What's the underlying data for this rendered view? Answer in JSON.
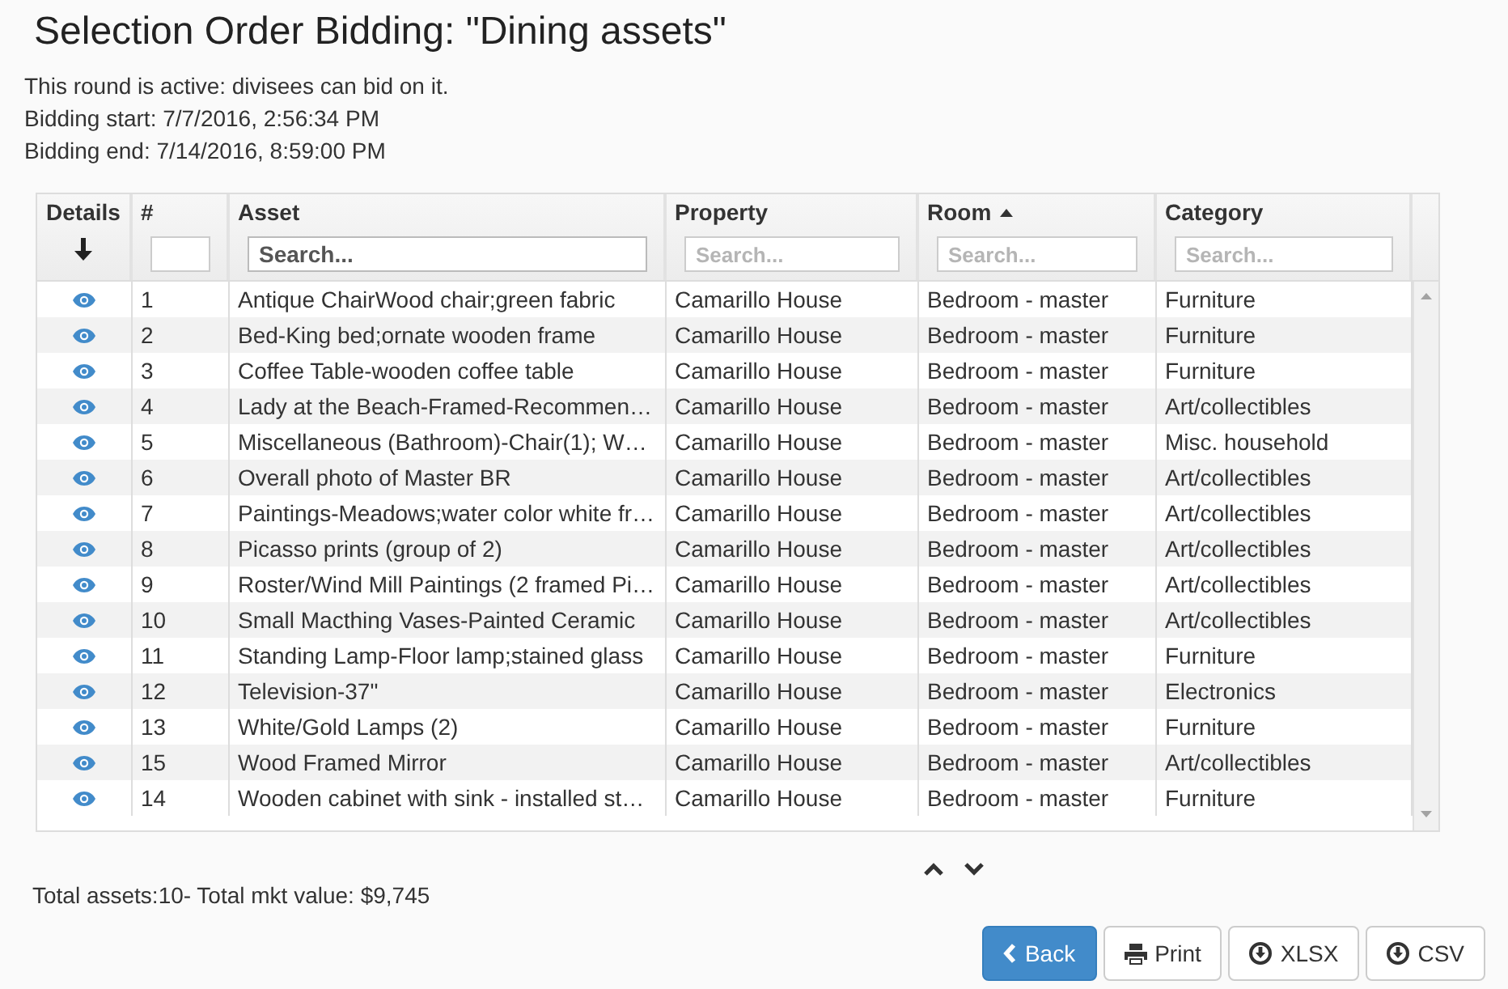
{
  "page": {
    "title": "Selection Order Bidding: \"Dining assets\"",
    "info_lines": [
      "This round is active: divisees can bid on it.",
      "Bidding start: 7/7/2016, 2:56:34 PM",
      "Bidding end: 7/14/2016, 8:59:00 PM"
    ]
  },
  "table": {
    "columns": [
      {
        "label": "Details",
        "sorted_ascending": false,
        "filter": {
          "kind": "arrow"
        }
      },
      {
        "label": "#",
        "sorted_ascending": false,
        "filter": {
          "kind": "field",
          "focused": false
        }
      },
      {
        "label": "Asset",
        "sorted_ascending": false,
        "filter": {
          "kind": "field",
          "placeholder": "Search...",
          "focused": true
        }
      },
      {
        "label": "Property",
        "sorted_ascending": false,
        "filter": {
          "kind": "field",
          "placeholder": "Search...",
          "focused": false
        }
      },
      {
        "label": "Room",
        "sorted_ascending": true,
        "filter": {
          "kind": "field",
          "placeholder": "Search...",
          "focused": false
        }
      },
      {
        "label": "Category",
        "sorted_ascending": false,
        "filter": {
          "kind": "field",
          "placeholder": "Search...",
          "focused": false
        }
      }
    ],
    "rows": [
      {
        "number": "1",
        "asset": "Antique ChairWood chair;green fabric",
        "property": "Camarillo House",
        "room": "Bedroom - master",
        "category": "Furniture"
      },
      {
        "number": "2",
        "asset": "Bed-King bed;ornate wooden frame",
        "property": "Camarillo House",
        "room": "Bedroom - master",
        "category": "Furniture"
      },
      {
        "number": "3",
        "asset": "Coffee Table-wooden coffee table",
        "property": "Camarillo House",
        "room": "Bedroom - master",
        "category": "Furniture"
      },
      {
        "number": "4",
        "asset": "Lady at the Beach-Framed-Recommen…",
        "property": "Camarillo House",
        "room": "Bedroom - master",
        "category": "Art/collectibles"
      },
      {
        "number": "5",
        "asset": "Miscellaneous (Bathroom)-Chair(1); W…",
        "property": "Camarillo House",
        "room": "Bedroom - master",
        "category": "Misc. household"
      },
      {
        "number": "6",
        "asset": "Overall photo of Master BR",
        "property": "Camarillo House",
        "room": "Bedroom - master",
        "category": "Art/collectibles"
      },
      {
        "number": "7",
        "asset": "Paintings-Meadows;water color white fr…",
        "property": "Camarillo House",
        "room": "Bedroom - master",
        "category": "Art/collectibles"
      },
      {
        "number": "8",
        "asset": "Picasso prints (group of 2)",
        "property": "Camarillo House",
        "room": "Bedroom - master",
        "category": "Art/collectibles"
      },
      {
        "number": "9",
        "asset": "Roster/Wind Mill Paintings (2 framed Pi…",
        "property": "Camarillo House",
        "room": "Bedroom - master",
        "category": "Art/collectibles"
      },
      {
        "number": "10",
        "asset": "Small Macthing Vases-Painted Ceramic",
        "property": "Camarillo House",
        "room": "Bedroom - master",
        "category": "Art/collectibles"
      },
      {
        "number": "11",
        "asset": "Standing Lamp-Floor lamp;stained glass",
        "property": "Camarillo House",
        "room": "Bedroom - master",
        "category": "Furniture"
      },
      {
        "number": "12",
        "asset": "Television-37\"",
        "property": "Camarillo House",
        "room": "Bedroom - master",
        "category": "Electronics"
      },
      {
        "number": "13",
        "asset": "White/Gold Lamps (2)",
        "property": "Camarillo House",
        "room": "Bedroom - master",
        "category": "Furniture"
      },
      {
        "number": "15",
        "asset": "Wood Framed Mirror",
        "property": "Camarillo House",
        "room": "Bedroom - master",
        "category": "Art/collectibles"
      },
      {
        "number": "14",
        "asset": "Wooden cabinet with sink - installed st…",
        "property": "Camarillo House",
        "room": "Bedroom - master",
        "category": "Furniture"
      }
    ]
  },
  "footer": {
    "summary": "Total assets:10- Total mkt value: $9,745"
  },
  "buttons": [
    {
      "label": "Back",
      "kind": "back",
      "primary": true
    },
    {
      "label": "Print",
      "kind": "print",
      "primary": false
    },
    {
      "label": "XLSX",
      "kind": "download",
      "primary": false
    },
    {
      "label": "CSV",
      "kind": "download",
      "primary": false
    }
  ]
}
